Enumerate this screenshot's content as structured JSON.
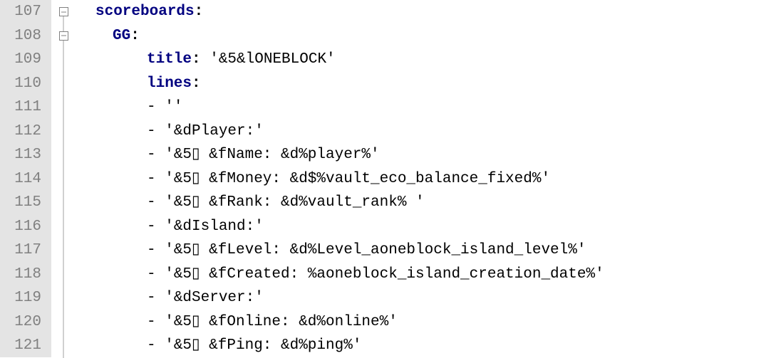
{
  "lines": [
    {
      "num": "107",
      "fold": "box",
      "indent": "i0",
      "key": "scoreboards",
      "colon": ":",
      "rest": ""
    },
    {
      "num": "108",
      "fold": "box",
      "indent": "i1",
      "key": "GG",
      "colon": ":",
      "rest": ""
    },
    {
      "num": "109",
      "fold": "bar",
      "indent": "i2",
      "key": "title",
      "colon": ":",
      "rest": " '&5&lONEBLOCK'"
    },
    {
      "num": "110",
      "fold": "bar",
      "indent": "i2",
      "key": "lines",
      "colon": ":",
      "rest": ""
    },
    {
      "num": "111",
      "fold": "bar",
      "indent": "i3",
      "dash": "- ",
      "rest": "''"
    },
    {
      "num": "112",
      "fold": "bar",
      "indent": "i3",
      "dash": "- ",
      "rest": "'&dPlayer:'"
    },
    {
      "num": "113",
      "fold": "bar",
      "indent": "i3",
      "dash": "- ",
      "rest": "'&5▯ &fName: &d%player%'"
    },
    {
      "num": "114",
      "fold": "bar",
      "indent": "i3",
      "dash": "- ",
      "rest": "'&5▯ &fMoney: &d$%vault_eco_balance_fixed%'"
    },
    {
      "num": "115",
      "fold": "bar",
      "indent": "i3",
      "dash": "- ",
      "rest": "'&5▯ &fRank: &d%vault_rank% '"
    },
    {
      "num": "116",
      "fold": "bar",
      "indent": "i3",
      "dash": "- ",
      "rest": "'&dIsland:'"
    },
    {
      "num": "117",
      "fold": "bar",
      "indent": "i3",
      "dash": "- ",
      "rest": "'&5▯ &fLevel: &d%Level_aoneblock_island_level%'"
    },
    {
      "num": "118",
      "fold": "bar",
      "indent": "i3",
      "dash": "- ",
      "rest": "'&5▯ &fCreated: %aoneblock_island_creation_date%'"
    },
    {
      "num": "119",
      "fold": "bar",
      "indent": "i3",
      "dash": "- ",
      "rest": "'&dServer:'"
    },
    {
      "num": "120",
      "fold": "bar",
      "indent": "i3",
      "dash": "- ",
      "rest": "'&5▯ &fOnline: &d%online%'"
    },
    {
      "num": "121",
      "fold": "bar",
      "indent": "i3",
      "dash": "- ",
      "rest": "'&5▯ &fPing: &d%ping%'"
    }
  ]
}
